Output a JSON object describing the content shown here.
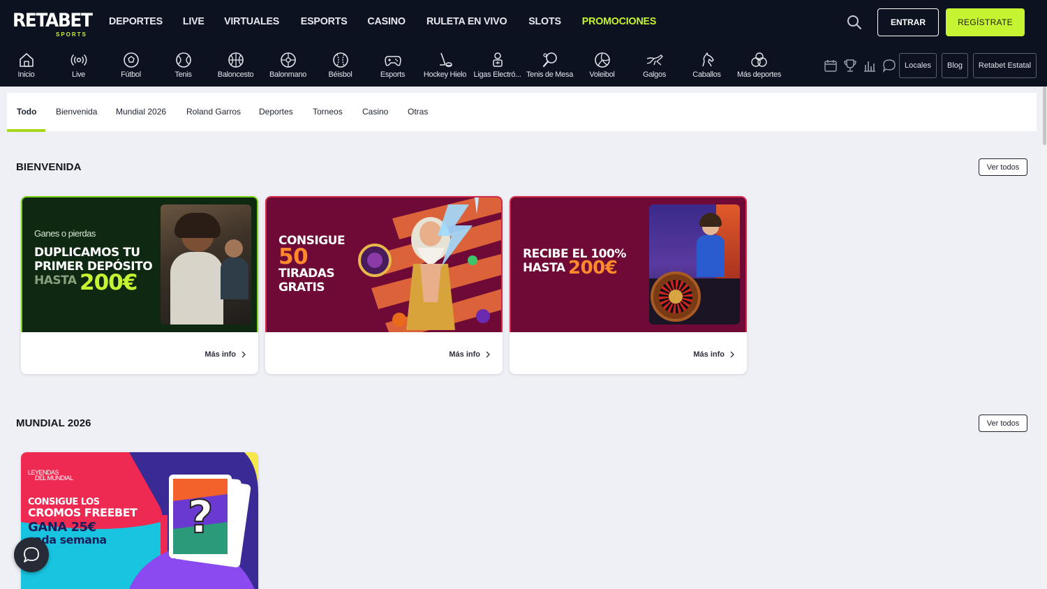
{
  "header": {
    "logo_main": "RETABET",
    "logo_sub": "SPORTS",
    "nav": [
      "DEPORTES",
      "LIVE",
      "VIRTUALES",
      "ESPORTS",
      "CASINO",
      "RULETA EN VIVO",
      "SLOTS",
      "PROMOCIONES"
    ],
    "login_label": "ENTRAR",
    "register_label": "REGÍSTRATE",
    "accent_color": "#c6f432"
  },
  "sports": [
    {
      "label": "Inicio",
      "icon": "home-icon"
    },
    {
      "label": "Live",
      "icon": "live-icon"
    },
    {
      "label": "Fútbol",
      "icon": "football-icon"
    },
    {
      "label": "Tenis",
      "icon": "tennis-icon"
    },
    {
      "label": "Baloncesto",
      "icon": "basketball-icon"
    },
    {
      "label": "Balonmano",
      "icon": "handball-icon"
    },
    {
      "label": "Béisbol",
      "icon": "baseball-icon"
    },
    {
      "label": "Esports",
      "icon": "gamepad-icon"
    },
    {
      "label": "Hockey Hielo",
      "icon": "hockey-icon"
    },
    {
      "label": "Ligas Electró...",
      "icon": "esports-league-icon"
    },
    {
      "label": "Tenis de Mesa",
      "icon": "table-tennis-icon"
    },
    {
      "label": "Voleibol",
      "icon": "volleyball-icon"
    },
    {
      "label": "Galgos",
      "icon": "greyhound-icon"
    },
    {
      "label": "Caballos",
      "icon": "horse-icon"
    },
    {
      "label": "Más deportes",
      "icon": "more-sports-icon"
    }
  ],
  "utility": {
    "icons": [
      "calendar-icon",
      "trophy-icon",
      "stats-icon",
      "chat-bubble-icon"
    ],
    "buttons": [
      "Locales",
      "Blog",
      "Retabet Estatal"
    ]
  },
  "tabs": [
    "Todo",
    "Bienvenida",
    "Mundial 2026",
    "Roland Garros",
    "Deportes",
    "Torneos",
    "Casino",
    "Otras"
  ],
  "active_tab": "Todo",
  "sections": {
    "bienvenida": {
      "title": "BIENVENIDA",
      "see_all": "Ver todos",
      "cards": [
        {
          "more": "Más info",
          "small": "Ganes o pierdas",
          "line1": "DUPLICAMOS TU",
          "line2": "PRIMER DEPÓSITO",
          "hasta": "HASTA",
          "amount": "200€"
        },
        {
          "more": "Más info",
          "line1": "CONSIGUE",
          "big": "50",
          "line2": "TIRADAS",
          "line3": "GRATIS"
        },
        {
          "more": "Más info",
          "line1": "RECIBE EL 100%",
          "hasta": "HASTA",
          "amount": "200€"
        }
      ]
    },
    "mundial": {
      "title": "MUNDIAL 2026",
      "see_all": "Ver todos",
      "cards": [
        {
          "tag1": "LEYENDAS",
          "tag2": "DEL MUNDIAL",
          "line1": "CONSIGUE LOS",
          "line2": "CROMOS FREEBET",
          "line3": "GANA 25€",
          "line4": "cada semana"
        }
      ]
    }
  }
}
